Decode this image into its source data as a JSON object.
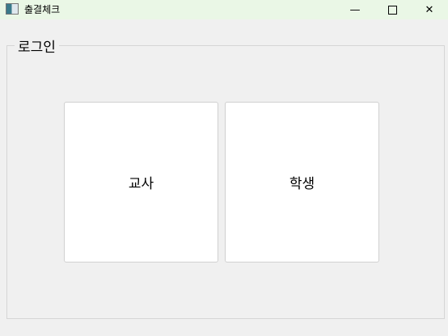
{
  "window": {
    "title": "출결체크",
    "minimize_icon": "minimize-icon",
    "maximize_icon": "maximize-icon",
    "close_icon": "close-icon"
  },
  "login_group": {
    "label": "로그인",
    "teacher_button": "교사",
    "student_button": "학생"
  }
}
